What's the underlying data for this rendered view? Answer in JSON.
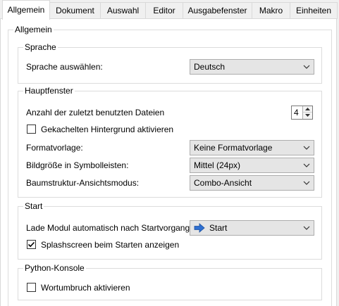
{
  "tabs": [
    {
      "label": "Allgemein",
      "active": true
    },
    {
      "label": "Dokument",
      "active": false
    },
    {
      "label": "Auswahl",
      "active": false
    },
    {
      "label": "Editor",
      "active": false
    },
    {
      "label": "Ausgabefenster",
      "active": false
    },
    {
      "label": "Makro",
      "active": false
    },
    {
      "label": "Einheiten",
      "active": false
    }
  ],
  "outer_group": {
    "title": "Allgemein"
  },
  "sprache": {
    "title": "Sprache",
    "label": "Sprache auswählen:",
    "value": "Deutsch"
  },
  "hauptfenster": {
    "title": "Hauptfenster",
    "recent_files_label": "Anzahl der zuletzt benutzten Dateien",
    "recent_files_value": "4",
    "tiled_bg_label": "Gekachelten Hintergrund aktivieren",
    "tiled_bg_checked": false,
    "style_label": "Formatvorlage:",
    "style_value": "Keine Formatvorlage",
    "icon_size_label": "Bildgröße in Symbolleisten:",
    "icon_size_value": "Mittel (24px)",
    "tree_mode_label": "Baumstruktur-Ansichtsmodus:",
    "tree_mode_value": "Combo-Ansicht"
  },
  "start": {
    "title": "Start",
    "module_label": "Lade Modul automatisch nach Startvorgang:",
    "module_value": "Start",
    "module_icon": "arrow-right-icon",
    "splash_label": "Splashscreen beim Starten anzeigen",
    "splash_checked": true
  },
  "python": {
    "title": "Python-Konsole",
    "wrap_label": "Wortumbruch aktivieren",
    "wrap_checked": false
  },
  "colors": {
    "accent_blue": "#2e6fd1",
    "check_mark": "#000000"
  }
}
